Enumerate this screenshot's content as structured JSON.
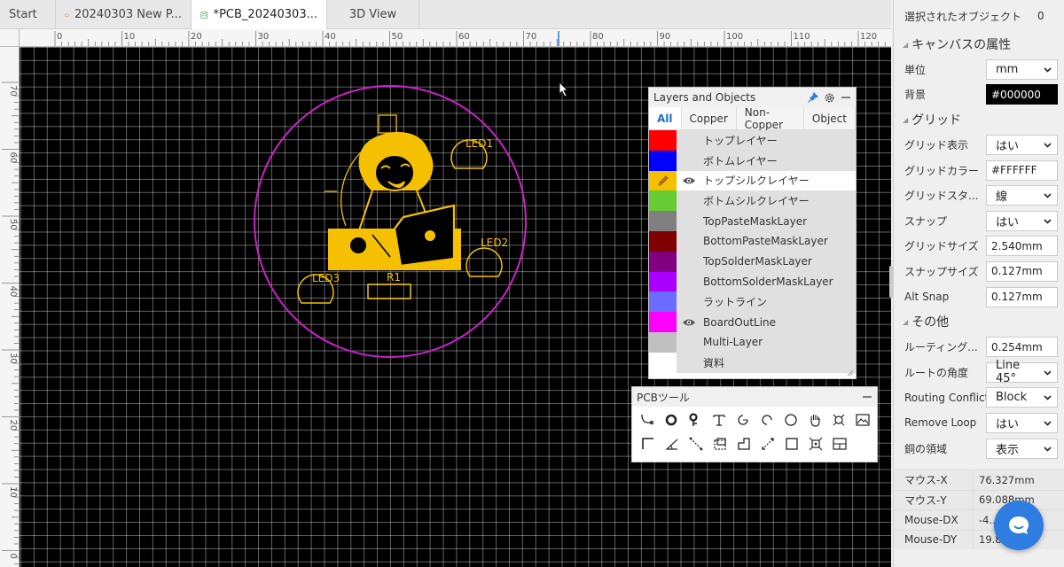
{
  "tabs": [
    {
      "label": "Start"
    },
    {
      "label": "20240303 New P..."
    },
    {
      "label": "*PCB_20240303..."
    },
    {
      "label": "3D View"
    }
  ],
  "ruler": {
    "h_labels": [
      "0",
      "10",
      "20",
      "30",
      "40",
      "50",
      "60",
      "70",
      "80",
      "90",
      "100",
      "110",
      "120"
    ],
    "v_labels": [
      "70",
      "60",
      "50",
      "40",
      "30",
      "20",
      "10",
      "0"
    ]
  },
  "board": {
    "silk_labels": {
      "led1": "LED1",
      "led2": "LED2",
      "led3": "LED3",
      "r1": "R1"
    },
    "colors": {
      "silk": "#f5c000",
      "outline": "#cc22cc",
      "grid": "#ffffff",
      "background": "#000000"
    }
  },
  "layers_panel": {
    "title": "Layers and Objects",
    "tabs": [
      "All",
      "Copper",
      "Non-Copper",
      "Object"
    ],
    "active_tab": "All",
    "rows": [
      {
        "name": "トップレイヤー",
        "color": "#ff0000",
        "visible": false
      },
      {
        "name": "ボトムレイヤー",
        "color": "#0000ff",
        "visible": false
      },
      {
        "name": "トップシルクレイヤー",
        "color": "#f5c000",
        "visible": true
      },
      {
        "name": "ボトムシルクレイヤー",
        "color": "#66cc33",
        "visible": false
      },
      {
        "name": "TopPasteMaskLayer",
        "color": "#808080",
        "visible": false
      },
      {
        "name": "BottomPasteMaskLayer",
        "color": "#800000",
        "visible": false
      },
      {
        "name": "TopSolderMaskLayer",
        "color": "#800080",
        "visible": false
      },
      {
        "name": "BottomSolderMaskLayer",
        "color": "#aa00ff",
        "visible": false
      },
      {
        "name": "ラットライン",
        "color": "#6b6bff",
        "visible": false
      },
      {
        "name": "BoardOutLine",
        "color": "#ff00ff",
        "visible": true
      },
      {
        "name": "Multi-Layer",
        "color": "#c0c0c0",
        "visible": false
      },
      {
        "name": "資料",
        "color": "#ffffff",
        "visible": false
      }
    ]
  },
  "tools_panel": {
    "title": "PCBツール",
    "row1": [
      "track-icon",
      "pad-icon",
      "via-icon",
      "text-icon",
      "arc-icon",
      "arc2-icon",
      "circle-icon",
      "hand-icon",
      "drill-icon",
      "image-icon"
    ],
    "row2": [
      "corner-icon",
      "angle-icon",
      "dimension-icon",
      "copper-area-icon",
      "solid-region-icon",
      "measure-icon",
      "rectangle-icon",
      "component-icon",
      "table-icon"
    ]
  },
  "props": {
    "selected_label": "選択されたオブジェクト",
    "selected_count": "0",
    "canvas_section": "キャンバスの属性",
    "unit_label": "単位",
    "unit_value": "mm",
    "bg_label": "背景",
    "bg_value": "#000000",
    "grid_section": "グリッド",
    "grid_show_label": "グリッド表示",
    "grid_show_value": "はい",
    "grid_color_label": "グリッドカラー",
    "grid_color_value": "#FFFFFF",
    "grid_style_label": "グリッドスタ...",
    "grid_style_value": "線",
    "snap_label": "スナップ",
    "snap_value": "はい",
    "grid_size_label": "グリッドサイズ",
    "grid_size_value": "2.540mm",
    "snap_size_label": "スナップサイズ",
    "snap_size_value": "0.127mm",
    "alt_snap_label": "Alt Snap",
    "alt_snap_value": "0.127mm",
    "other_section": "その他",
    "routing_label": "ルーティング...",
    "routing_value": "0.254mm",
    "route_angle_label": "ルートの角度",
    "route_angle_value": "Line 45°",
    "conflict_label": "Routing Conflict",
    "conflict_value": "Block",
    "remove_loop_label": "Remove Loop",
    "remove_loop_value": "はい",
    "copper_label": "銅の領域",
    "copper_value": "表示"
  },
  "mouse": [
    {
      "label": "マウス-X",
      "value": "76.327mm"
    },
    {
      "label": "マウス-Y",
      "value": "69.088mm"
    },
    {
      "label": "Mouse-DX",
      "value": "-4..."
    },
    {
      "label": "Mouse-DY",
      "value": "19.8..."
    }
  ]
}
